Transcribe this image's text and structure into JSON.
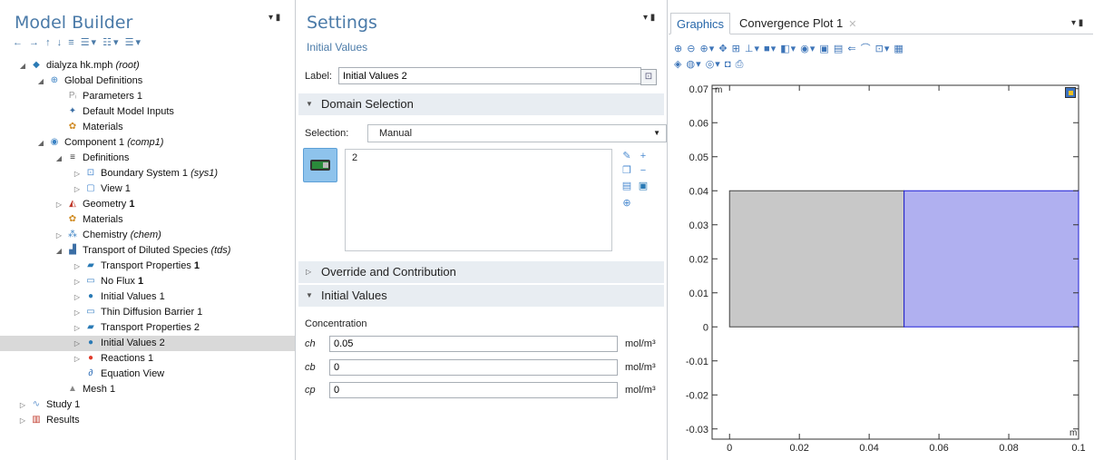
{
  "model_builder": {
    "title": "Model Builder",
    "toolbar": "← → ↑ ↓ ≡ ☰▾ ☷▾ ☰▾",
    "tree": [
      {
        "label": "dialyza hk.mph",
        "suffix": "(root)",
        "indent": 0,
        "arrow": "◢",
        "icon": "model-icon"
      },
      {
        "label": "Global Definitions",
        "indent": 1,
        "arrow": "◢",
        "icon": "globe-icon"
      },
      {
        "label": "Parameters 1",
        "indent": 2,
        "icon": "parameters-icon"
      },
      {
        "label": "Default Model Inputs",
        "indent": 2,
        "icon": "model-inputs-icon"
      },
      {
        "label": "Materials",
        "indent": 2,
        "icon": "materials-icon"
      },
      {
        "label": "Component 1",
        "suffix": "(comp1)",
        "indent": 1,
        "arrow": "◢",
        "icon": "component-icon"
      },
      {
        "label": "Definitions",
        "indent": 2,
        "arrow": "◢",
        "icon": "definitions-icon"
      },
      {
        "label": "Boundary System 1",
        "suffix": "(sys1)",
        "indent": 3,
        "arrow": "▷",
        "icon": "boundary-system-icon"
      },
      {
        "label": "View 1",
        "indent": 3,
        "arrow": "▷",
        "icon": "view-icon"
      },
      {
        "label": "Geometry",
        "bold_suffix": "1",
        "indent": 2,
        "arrow": "▷",
        "icon": "geometry-icon"
      },
      {
        "label": "Materials",
        "indent": 2,
        "icon": "materials-icon"
      },
      {
        "label": "Chemistry",
        "suffix": "(chem)",
        "indent": 2,
        "arrow": "▷",
        "icon": "chemistry-icon"
      },
      {
        "label": "Transport of Diluted Species",
        "suffix": "(tds)",
        "indent": 2,
        "arrow": "◢",
        "icon": "transport-icon"
      },
      {
        "label": "Transport Properties",
        "bold_suffix": "1",
        "indent": 3,
        "arrow": "▷",
        "icon": "transport-properties-icon"
      },
      {
        "label": "No Flux",
        "bold_suffix": "1",
        "indent": 3,
        "arrow": "▷",
        "icon": "no-flux-icon"
      },
      {
        "label": "Initial Values 1",
        "indent": 3,
        "arrow": "▷",
        "icon": "initial-values-icon"
      },
      {
        "label": "Thin Diffusion Barrier 1",
        "indent": 3,
        "arrow": "▷",
        "icon": "barrier-icon"
      },
      {
        "label": "Transport Properties 2",
        "indent": 3,
        "arrow": "▷",
        "icon": "transport-properties-icon"
      },
      {
        "label": "Initial Values 2",
        "indent": 3,
        "arrow": "▷",
        "icon": "initial-values-icon",
        "selected": true
      },
      {
        "label": "Reactions 1",
        "indent": 3,
        "arrow": "▷",
        "icon": "reactions-icon"
      },
      {
        "label": "Equation View",
        "indent": 3,
        "icon": "equation-view-icon"
      },
      {
        "label": "Mesh 1",
        "indent": 2,
        "icon": "mesh-icon"
      },
      {
        "label": "Study 1",
        "indent": 0,
        "arrow": "▷",
        "icon": "study-icon"
      },
      {
        "label": "Results",
        "indent": 0,
        "arrow": "▷",
        "icon": "results-icon"
      }
    ]
  },
  "settings": {
    "title": "Settings",
    "subtitle": "Initial Values",
    "label_key": "Label:",
    "label_value": "Initial Values 2",
    "sections": {
      "domain_selection": "Domain Selection",
      "override": "Override and Contribution",
      "initial_values": "Initial Values"
    },
    "selection_key": "Selection:",
    "selection_value": "Manual",
    "selection_list": [
      "2"
    ],
    "concentration_title": "Concentration",
    "variables": [
      {
        "name": "ch",
        "value": "0.05",
        "unit": "mol/m³"
      },
      {
        "name": "cb",
        "value": "0",
        "unit": "mol/m³"
      },
      {
        "name": "cp",
        "value": "0",
        "unit": "mol/m³"
      }
    ]
  },
  "graphics": {
    "tabs": [
      "Graphics",
      "Convergence Plot 1"
    ],
    "toolbar_row1": "⊕ ⊖ ⊕▾ ✥ ⊞ ⊥▾ ■▾ ◧▾ ◉▾ ▣ ▤ ⇐ ⌒ ⊡▾ ▦",
    "toolbar_row2": "◈ ◍▾ ◎▾ ◘ ⎙",
    "axis_unit": "m",
    "x_ticks": [
      "0",
      "0.02",
      "0.04",
      "0.06",
      "0.08",
      "0.1"
    ],
    "y_ticks": [
      "0.07",
      "0.06",
      "0.05",
      "0.04",
      "0.03",
      "0.02",
      "0.01",
      "0",
      "-0.01",
      "-0.02",
      "-0.03"
    ],
    "xlim": [
      -0.005,
      0.1
    ],
    "ylim": [
      -0.033,
      0.071
    ],
    "domains": [
      {
        "x0": 0,
        "x1": 0.05,
        "y0": 0,
        "y1": 0.04,
        "fill": "#c8c8c8",
        "stroke": "#444444"
      },
      {
        "x0": 0.05,
        "x1": 0.1,
        "y0": 0,
        "y1": 0.04,
        "fill": "#b0b0f0",
        "stroke": "#1f1fd6"
      }
    ]
  }
}
